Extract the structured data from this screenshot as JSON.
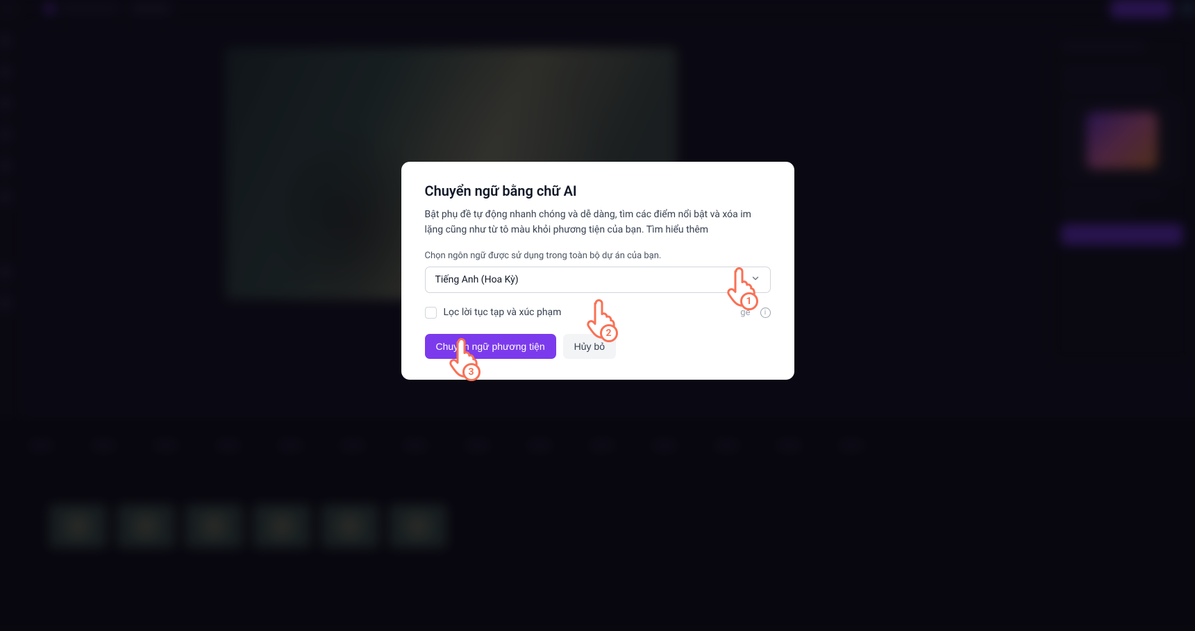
{
  "modal": {
    "title": "Chuyển ngữ bằng chữ AI",
    "description": "Bật phụ đề tự động nhanh chóng và dễ dàng, tìm các điểm nổi bật và xóa im lặng cũng như từ tô màu khỏi phương tiện của bạn. Tìm hiểu thêm",
    "select_label": "Chọn ngôn ngữ được sử dụng trong toàn bộ dự án của bạn.",
    "language_value": "Tiếng Anh (Hoa Kỳ)",
    "filter_label": "Lọc lời tục tạp và xúc phạm",
    "ghost_text": "ge",
    "primary_button": "Chuyển ngữ phương tiện",
    "secondary_button": "Hủy bỏ"
  },
  "pointers": {
    "p1": "1",
    "p2": "2",
    "p3": "3"
  }
}
